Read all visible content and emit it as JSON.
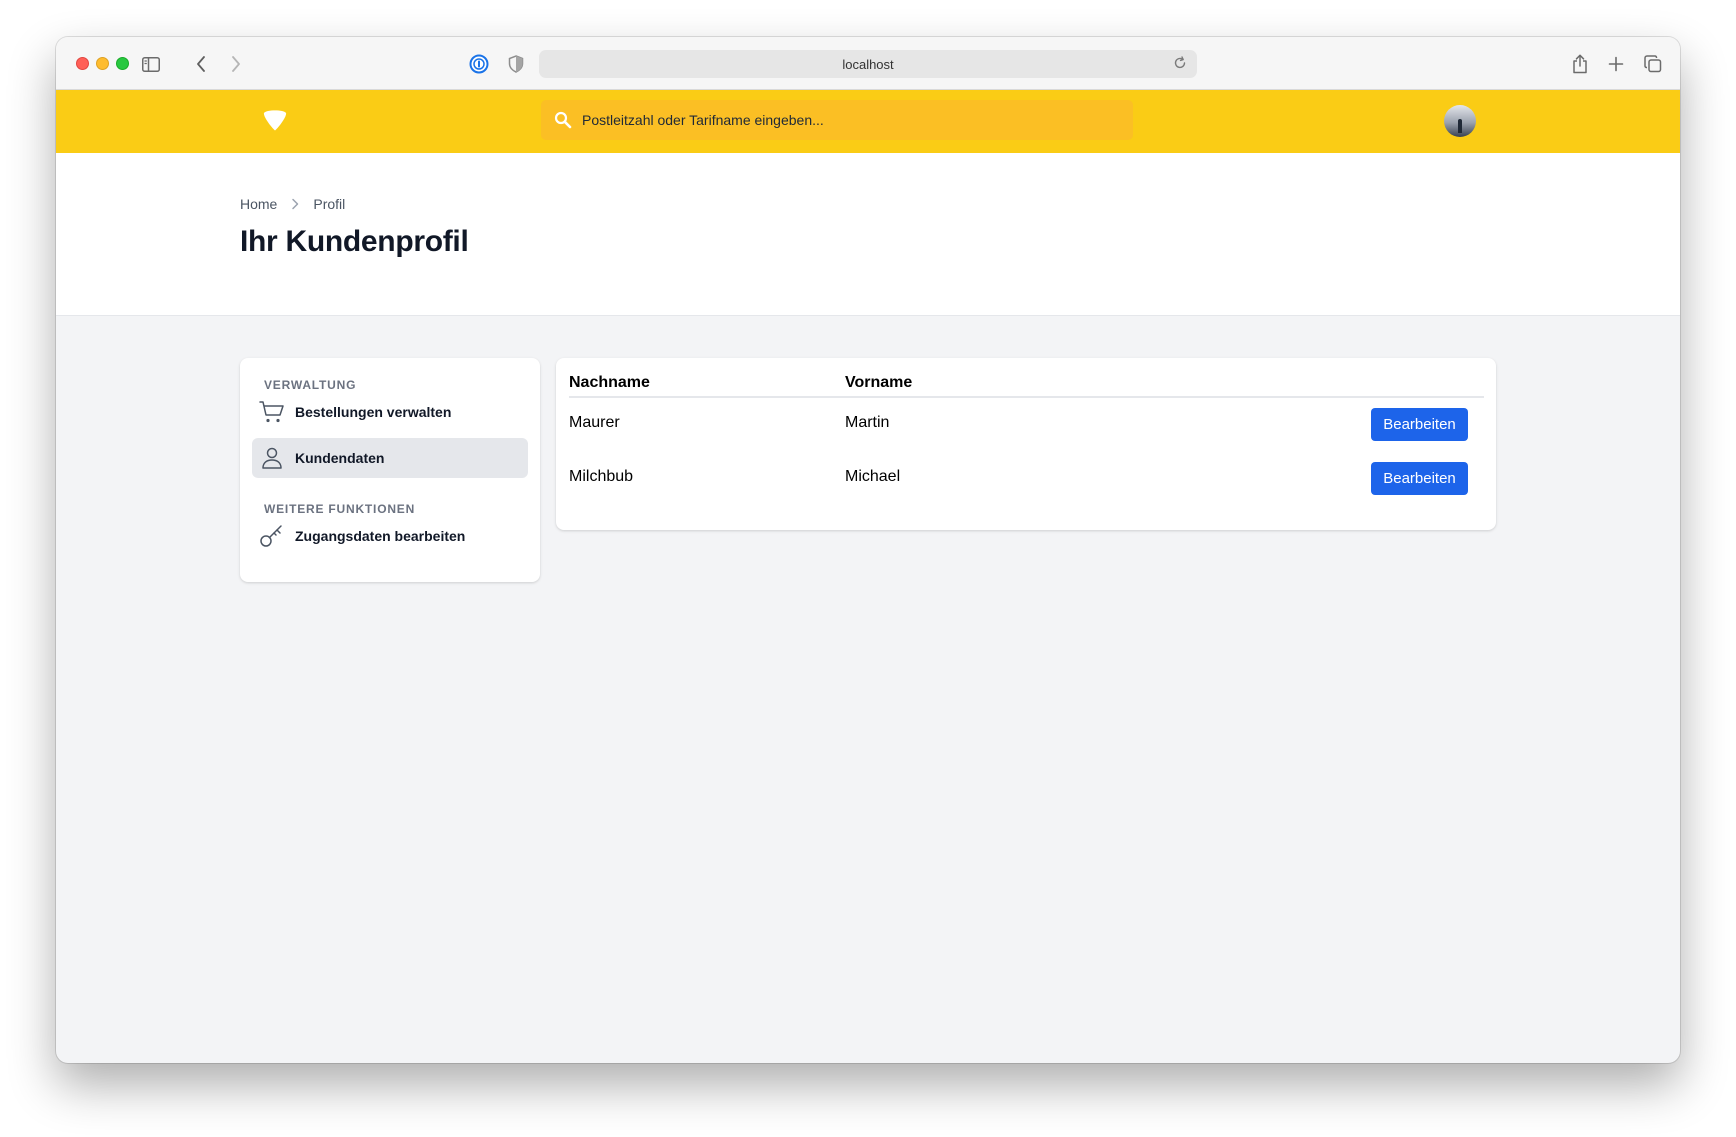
{
  "browser": {
    "url": "localhost"
  },
  "search": {
    "placeholder": "Postleitzahl oder Tarifname eingeben..."
  },
  "breadcrumb": {
    "items": [
      "Home",
      "Profil"
    ]
  },
  "page": {
    "title": "Ihr Kundenprofil"
  },
  "sidebar": {
    "sections": [
      {
        "label": "VERWALTUNG",
        "items": [
          {
            "label": "Bestellungen verwalten",
            "icon": "cart-icon",
            "active": false
          },
          {
            "label": "Kundendaten",
            "icon": "user-icon",
            "active": true
          }
        ]
      },
      {
        "label": "WEITERE FUNKTIONEN",
        "items": [
          {
            "label": "Zugangsdaten bearbeiten",
            "icon": "key-icon",
            "active": false
          }
        ]
      }
    ]
  },
  "table": {
    "headers": [
      "Nachname",
      "Vorname"
    ],
    "rows": [
      {
        "nachname": "Maurer",
        "vorname": "Martin",
        "action": "Bearbeiten"
      },
      {
        "nachname": "Milchbub",
        "vorname": "Michael",
        "action": "Bearbeiten"
      }
    ]
  },
  "colors": {
    "header_yellow": "#facc15",
    "search_bg": "#fbbf24",
    "button_blue": "#1d64ea",
    "page_bg": "#f3f4f6"
  }
}
